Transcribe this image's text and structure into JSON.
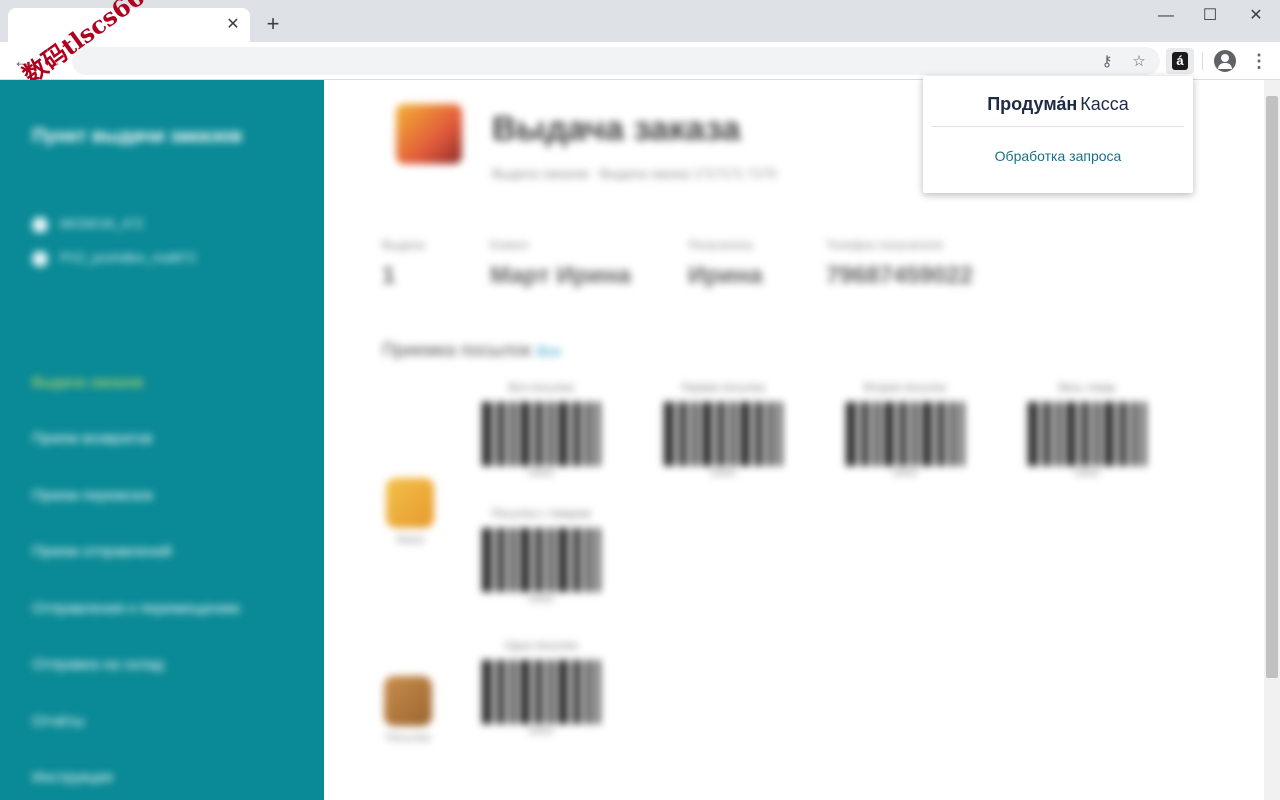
{
  "browser": {
    "tab": {
      "close_glyph": "✕"
    },
    "new_tab_glyph": "+",
    "window_controls": {
      "minimize": "—",
      "maximize": "☐",
      "close": "✕"
    },
    "nav": {
      "back": "←",
      "forward": "→"
    },
    "omnibox_icons": {
      "key": "⚷",
      "star": "☆"
    },
    "extension_glyph": "á",
    "menu_glyph": "⋮"
  },
  "watermark": "数码tlscs66",
  "popup": {
    "brand_bold": "Продума́н",
    "brand_regular": "Касса",
    "status": "Обработка запроса"
  },
  "sidebar": {
    "title": "Пункт выдачи заказов",
    "meta": [
      "MOSKVA_472",
      "PVZ_pozhdtes_mat872"
    ],
    "items": [
      {
        "label": "Выдача заказов",
        "active": true
      },
      {
        "label": "Прием возвратов",
        "active": false
      },
      {
        "label": "Прием перевозок",
        "active": false
      },
      {
        "label": "Прием отправлений",
        "active": false
      },
      {
        "label": "Отправления к перемещению",
        "active": false
      },
      {
        "label": "Отправка на склад",
        "active": false
      },
      {
        "label": "Отчёты",
        "active": false
      },
      {
        "label": "Инструкция",
        "active": false
      }
    ]
  },
  "main": {
    "title": "Выдача заказа",
    "crumbs": "Выдача заказов  ·  Выдача заказа 1717171 7170",
    "info": [
      {
        "label": "Выдача",
        "value": "1"
      },
      {
        "label": "Клиент",
        "value": "Март Ирина"
      },
      {
        "label": "Получатель",
        "value": "Ирина"
      },
      {
        "label": "Телефон получателя",
        "value": "79687459022"
      }
    ],
    "section_title": "Приемка посылок",
    "section_link": "Все",
    "group1_label": "Заказ",
    "group2_label": "Посылка",
    "barcodes": [
      {
        "label": "Вся посылка",
        "code": "00000"
      },
      {
        "label": "Первая посылка",
        "code": "00000"
      },
      {
        "label": "Вторая посылка",
        "code": "00000"
      },
      {
        "label": "Весь товар",
        "code": "00000"
      },
      {
        "label": "Посылка с товаром",
        "code": "00000"
      },
      {
        "label": "Одна посылка",
        "code": "00000"
      }
    ]
  },
  "colors": {
    "sidebar_bg": "#0a8a96",
    "active_item": "#d8e45a",
    "popup_status": "#1a6f8a"
  }
}
